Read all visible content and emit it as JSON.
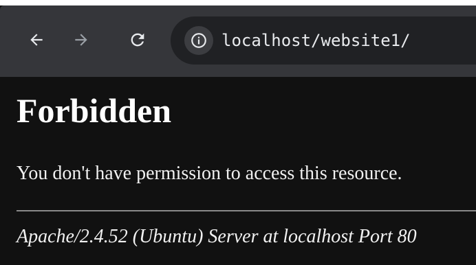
{
  "browser": {
    "url": "localhost/website1/",
    "icons": {
      "back": "arrow-left-icon",
      "forward": "arrow-right-icon",
      "reload": "reload-icon",
      "site_info": "info-icon"
    },
    "colors": {
      "toolbar": "#35363a",
      "omnibox": "#202124",
      "text": "#e8eaed",
      "disabled": "#9aa0a6"
    }
  },
  "page": {
    "title": "Forbidden",
    "message": "You don't have permission to access this resource.",
    "address": "Apache/2.4.52 (Ubuntu) Server at localhost Port 80",
    "colors": {
      "background": "#111111",
      "text": "#ffffff",
      "divider": "#8a8a8a"
    }
  }
}
